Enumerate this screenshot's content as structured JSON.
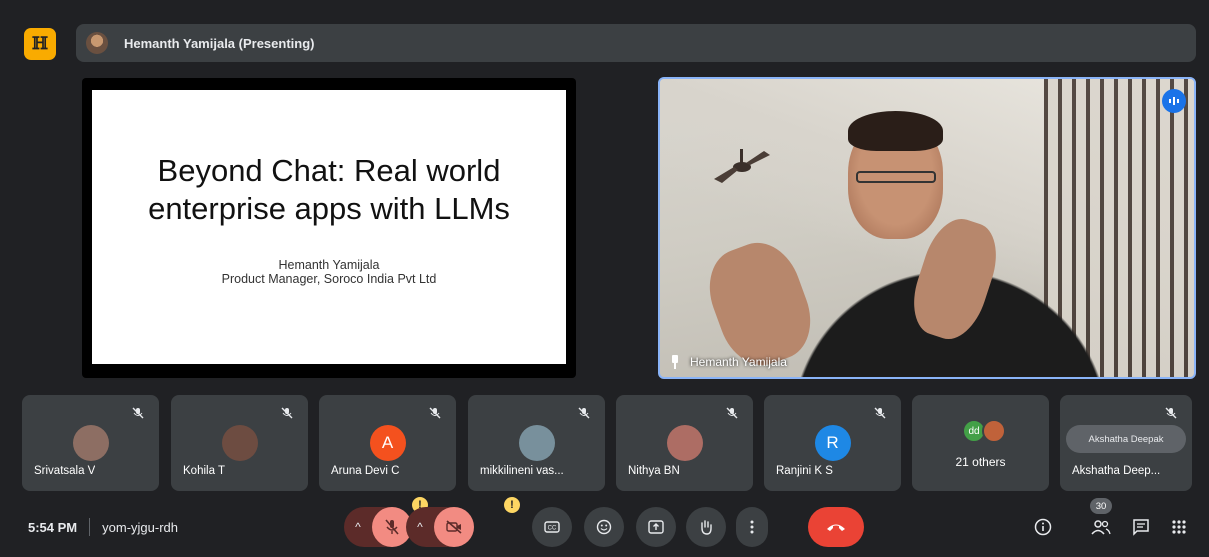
{
  "presenter_bar": {
    "text": "Hemanth Yamijala (Presenting)"
  },
  "slide": {
    "title_line1": "Beyond Chat: Real world",
    "title_line2": "enterprise apps with LLMs",
    "author": "Hemanth Yamijala",
    "role": "Product Manager, Soroco India Pvt Ltd"
  },
  "speaker_video": {
    "name": "Hemanth Yamijala"
  },
  "participants": [
    {
      "name": "Srivatsala V",
      "avatar": "photo",
      "color": "#8d6e63"
    },
    {
      "name": "Kohila T",
      "avatar": "photo",
      "color": "#6d4c41"
    },
    {
      "name": "Aruna Devi C",
      "avatar": "A",
      "color": "#f4511e"
    },
    {
      "name": "mikkilineni vas...",
      "avatar": "photo",
      "color": "#78909c"
    },
    {
      "name": "Nithya BN",
      "avatar": "photo",
      "color": "#ad6d64"
    },
    {
      "name": "Ranjini K S",
      "avatar": "R",
      "color": "#1e88e5"
    }
  ],
  "others_tile": {
    "badge": "dd",
    "label": "21 others"
  },
  "last_tile": {
    "tooltip": "Akshatha Deepak",
    "name": "Akshatha Deep..."
  },
  "bottom": {
    "time": "5:54 PM",
    "meeting_code": "yom-yjgu-rdh",
    "participants_count": "30",
    "warn_mark": "!"
  },
  "colors": {
    "accent_blue": "#8ab4f8",
    "end_call_red": "#ea4335",
    "muted_red": "#f28b82",
    "logo_yellow": "#f9ab00"
  }
}
